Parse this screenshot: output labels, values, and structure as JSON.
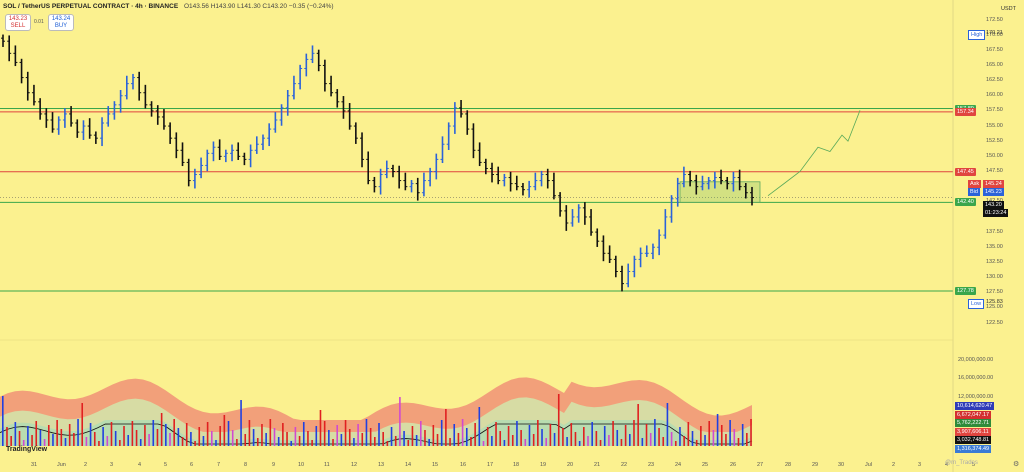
{
  "header": {
    "symbol": "SOL / TetherUS PERPETUAL CONTRACT · 4h · BINANCE",
    "ohlc": "O143.56 H143.90 L141.30 C143.20 −0.35 (−0.24%)"
  },
  "trade": {
    "sell_price": "143.23",
    "sell_label": "SELL",
    "spread": "0.01",
    "buy_price": "143.24",
    "buy_label": "BUY"
  },
  "axis_currency": "USDT",
  "colors": {
    "background": "#fbf18f",
    "up_candle": "#2b63d9",
    "down_candle": "#111111",
    "resistance": "#e0453f",
    "support": "#3aa64b",
    "volume_up": "#2040e0",
    "volume_down": "#e02020"
  },
  "chart_data": {
    "type": "ohlc",
    "interval": "4h",
    "ylim": [
      123.0,
      173.5
    ],
    "y_ticks": [
      "172.50",
      "170.00",
      "167.50",
      "165.00",
      "162.50",
      "160.00",
      "157.50",
      "155.00",
      "152.50",
      "150.00",
      "147.50",
      "145.00",
      "142.50",
      "140.00",
      "137.50",
      "135.00",
      "132.50",
      "130.00",
      "127.50",
      "125.00",
      "122.50"
    ],
    "x_ticks": [
      "31",
      "Jun",
      "2",
      "3",
      "4",
      "5",
      "6",
      "7",
      "8",
      "9",
      "10",
      "11",
      "12",
      "13",
      "14",
      "15",
      "16",
      "17",
      "18",
      "19",
      "20",
      "21",
      "22",
      "23",
      "24",
      "25",
      "26",
      "27",
      "28",
      "29",
      "30",
      "Jul",
      "2",
      "3",
      "4",
      "5"
    ],
    "price_markers": {
      "high": {
        "label": "High",
        "value": 170.21
      },
      "low": {
        "label": "Low",
        "value": 125.83
      },
      "ask": {
        "label": "Ask",
        "value": 145.24
      },
      "bid": {
        "label": "Bid",
        "value": 145.23
      },
      "last": {
        "value": "143.20",
        "countdown": "01:23:24"
      }
    },
    "levels": [
      {
        "value": 157.89,
        "kind": "support"
      },
      {
        "value": 157.34,
        "kind": "resistance"
      },
      {
        "value": 147.45,
        "kind": "resistance"
      },
      {
        "value": 142.4,
        "kind": "support"
      },
      {
        "value": 127.78,
        "kind": "support"
      }
    ],
    "close_path": [
      169,
      167,
      165.5,
      163,
      160.5,
      159,
      157,
      156,
      154.5,
      156,
      157,
      155.5,
      154,
      155,
      153.5,
      153,
      155.5,
      157,
      158.5,
      160,
      162,
      163,
      160.5,
      158.5,
      157.5,
      156.5,
      155,
      153,
      151,
      149,
      146,
      147,
      148.5,
      150.5,
      151.5,
      150,
      150.5,
      151,
      150,
      149.5,
      151,
      152,
      153,
      154.5,
      156,
      158,
      160,
      162,
      164.5,
      166,
      167,
      165,
      162,
      160.5,
      159,
      157.5,
      155,
      153,
      149.5,
      146,
      145,
      147,
      148,
      147.5,
      146,
      145,
      145.5,
      144,
      146,
      147.5,
      149.5,
      152,
      155,
      158,
      157,
      154.5,
      151,
      149,
      148,
      147,
      146,
      146.5,
      145.5,
      145,
      144.5,
      145,
      146,
      147,
      146,
      143.5,
      141,
      139,
      140,
      141.5,
      140,
      137.5,
      136,
      134,
      133,
      131,
      129,
      131,
      133,
      134,
      134,
      135,
      137,
      140,
      143,
      145.5,
      147,
      146,
      145,
      145.5,
      146,
      146.5,
      146,
      145.5,
      146.5,
      145,
      144,
      143.2
    ],
    "overlay": {
      "range_box": {
        "from": 145.8,
        "to": 142.4
      },
      "projection": [
        143.5,
        145.5,
        147.5,
        151.5,
        150.8,
        153.5,
        152.5,
        157.6
      ]
    },
    "volume": {
      "axis_ticks": [
        "20,000,000.00",
        "16,000,000.00",
        "12,000,000.00"
      ],
      "readouts": [
        {
          "value": "10,614,620.47",
          "color": "#2f3bb8"
        },
        {
          "value": "6,672,047.17",
          "color": "#d32f2f"
        },
        {
          "value": "5,762,222.71",
          "color": "#2e8b3a"
        },
        {
          "value": "3,907,606.11",
          "color": "#e0453f"
        },
        {
          "value": "3,032,748.81",
          "color": "#111111"
        },
        {
          "value": "1,316,374.49",
          "color": "#3a7bd5"
        }
      ]
    }
  },
  "branding": {
    "logo": "TradingView",
    "watermark": "@m_Trades"
  }
}
